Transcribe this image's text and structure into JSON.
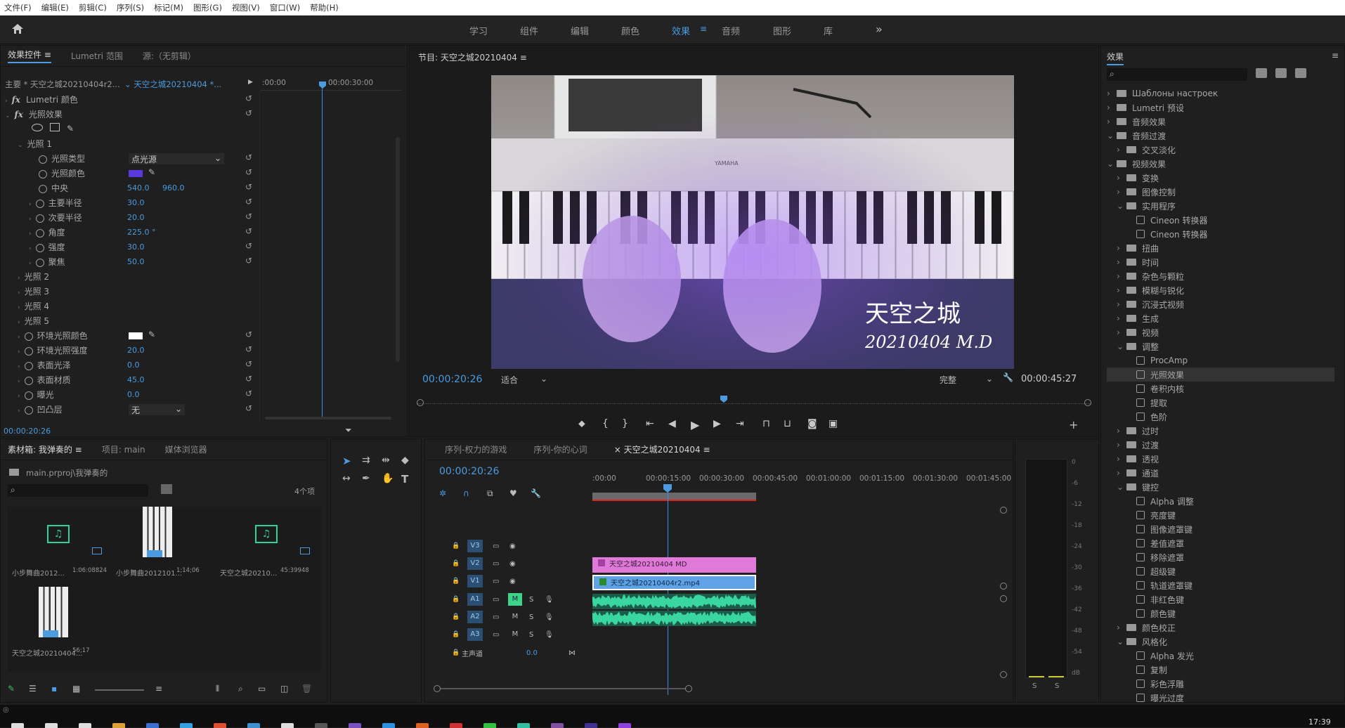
{
  "menu": [
    "文件(F)",
    "编辑(E)",
    "剪辑(C)",
    "序列(S)",
    "标记(M)",
    "图形(G)",
    "视图(V)",
    "窗口(W)",
    "帮助(H)"
  ],
  "workspaces": [
    "学习",
    "组件",
    "编辑",
    "颜色",
    "效果",
    "音频",
    "图形",
    "库"
  ],
  "workspace_active": "效果",
  "effect_controls": {
    "tabs": [
      "效果控件",
      "Lumetri 范围",
      "源:（无剪辑）"
    ],
    "master_clip": "主要 * 天空之城20210404r2...",
    "sequence_clip": "天空之城20210404 *...",
    "ruler_start": ":00:00",
    "ruler_end": "00:00:30:00",
    "lumetri": "Lumetri 颜色",
    "lighting": "光照效果",
    "light1": "光照 1",
    "params": [
      {
        "label": "光照类型",
        "value": "点光源"
      },
      {
        "label": "光照颜色",
        "value": ""
      },
      {
        "label": "中央",
        "value": "540.0",
        "value2": "960.0"
      },
      {
        "label": "主要半径",
        "value": "30.0"
      },
      {
        "label": "次要半径",
        "value": "20.0"
      },
      {
        "label": "角度",
        "value": "225.0 °"
      },
      {
        "label": "强度",
        "value": "30.0"
      },
      {
        "label": "聚焦",
        "value": "50.0"
      }
    ],
    "lights": [
      "光照 2",
      "光照 3",
      "光照 4",
      "光照 5"
    ],
    "ambient": [
      {
        "label": "环境光照颜色",
        "value": ""
      },
      {
        "label": "环境光照强度",
        "value": "20.0"
      },
      {
        "label": "表面光泽",
        "value": "0.0"
      },
      {
        "label": "表面材质",
        "value": "45.0"
      },
      {
        "label": "曝光",
        "value": "0.0"
      },
      {
        "label": "凹凸层",
        "value": "无"
      }
    ],
    "timecode": "00:00:20:26"
  },
  "program": {
    "title": "节目: 天空之城20210404",
    "overlay_title": "天空之城",
    "overlay_sub": "20210404 M.D",
    "brand": "YAMAHA",
    "timecode": "00:00:20:26",
    "fit": "适合",
    "quality": "完整",
    "duration": "00:00:45:27",
    "playhead": 0.45
  },
  "effects": {
    "title": "效果",
    "tree": [
      {
        "d": 0,
        "t": "folder",
        "l": "Шаблоны настроек"
      },
      {
        "d": 0,
        "t": "folder",
        "l": "Lumetri 预设"
      },
      {
        "d": 0,
        "t": "folder",
        "l": "音频效果"
      },
      {
        "d": 0,
        "t": "folder",
        "l": "音频过渡",
        "open": true
      },
      {
        "d": 1,
        "t": "folder",
        "l": "交叉淡化"
      },
      {
        "d": 0,
        "t": "folder",
        "l": "视频效果",
        "open": true
      },
      {
        "d": 1,
        "t": "folder",
        "l": "变换"
      },
      {
        "d": 1,
        "t": "folder",
        "l": "图像控制"
      },
      {
        "d": 1,
        "t": "folder",
        "l": "实用程序",
        "open": true
      },
      {
        "d": 2,
        "t": "fx",
        "l": "Cineon 转换器"
      },
      {
        "d": 2,
        "t": "fx",
        "l": "Cineon 转换器"
      },
      {
        "d": 1,
        "t": "folder",
        "l": "扭曲"
      },
      {
        "d": 1,
        "t": "folder",
        "l": "时间"
      },
      {
        "d": 1,
        "t": "folder",
        "l": "杂色与颗粒"
      },
      {
        "d": 1,
        "t": "folder",
        "l": "模糊与锐化"
      },
      {
        "d": 1,
        "t": "folder",
        "l": "沉浸式视频"
      },
      {
        "d": 1,
        "t": "folder",
        "l": "生成"
      },
      {
        "d": 1,
        "t": "folder",
        "l": "视频"
      },
      {
        "d": 1,
        "t": "folder",
        "l": "调整",
        "open": true
      },
      {
        "d": 2,
        "t": "fx",
        "l": "ProcAmp"
      },
      {
        "d": 2,
        "t": "fx",
        "l": "光照效果",
        "sel": true
      },
      {
        "d": 2,
        "t": "fx",
        "l": "卷积内核"
      },
      {
        "d": 2,
        "t": "fx",
        "l": "提取"
      },
      {
        "d": 2,
        "t": "fx",
        "l": "色阶"
      },
      {
        "d": 1,
        "t": "folder",
        "l": "过时"
      },
      {
        "d": 1,
        "t": "folder",
        "l": "过渡"
      },
      {
        "d": 1,
        "t": "folder",
        "l": "透视"
      },
      {
        "d": 1,
        "t": "folder",
        "l": "通道"
      },
      {
        "d": 1,
        "t": "folder",
        "l": "键控",
        "open": true
      },
      {
        "d": 2,
        "t": "fx",
        "l": "Alpha 调整"
      },
      {
        "d": 2,
        "t": "fx",
        "l": "亮度键"
      },
      {
        "d": 2,
        "t": "fx",
        "l": "图像遮罩键"
      },
      {
        "d": 2,
        "t": "fx",
        "l": "差值遮罩"
      },
      {
        "d": 2,
        "t": "fx",
        "l": "移除遮罩"
      },
      {
        "d": 2,
        "t": "fx",
        "l": "超级键"
      },
      {
        "d": 2,
        "t": "fx",
        "l": "轨道遮罩键"
      },
      {
        "d": 2,
        "t": "fx",
        "l": "非红色键"
      },
      {
        "d": 2,
        "t": "fx",
        "l": "颜色键"
      },
      {
        "d": 1,
        "t": "folder",
        "l": "颜色校正"
      },
      {
        "d": 1,
        "t": "folder",
        "l": "风格化",
        "open": true
      },
      {
        "d": 2,
        "t": "fx",
        "l": "Alpha 发光"
      },
      {
        "d": 2,
        "t": "fx",
        "l": "复制"
      },
      {
        "d": 2,
        "t": "fx",
        "l": "彩色浮雕"
      },
      {
        "d": 2,
        "t": "fx",
        "l": "曝光过度"
      }
    ]
  },
  "project": {
    "tabs": [
      "素材箱: 我弹奏的",
      "项目: main",
      "媒体浏览器"
    ],
    "path": "main.prproj\\我弹奏的",
    "count": "4个项",
    "items": [
      {
        "name": "小步舞曲2012...",
        "dur": "1:06:08824",
        "kind": "audio"
      },
      {
        "name": "小步舞曲2012101...",
        "dur": "1;14;06",
        "kind": "video"
      },
      {
        "name": "天空之城20210...",
        "dur": "45:39948",
        "kind": "audio"
      },
      {
        "name": "天空之城20210404...",
        "dur": "56;17",
        "kind": "video"
      }
    ]
  },
  "timeline": {
    "tabs": [
      "序列-权力的游戏",
      "序列-你的心词",
      "天空之城20210404"
    ],
    "timecode": "00:00:20:26",
    "ruler": [
      ":00:00",
      "00:00:15:00",
      "00:00:30:00",
      "00:00:45:00",
      "00:01:00:00",
      "00:01:15:00",
      "00:01:30:00",
      "00:01:45:00"
    ],
    "video_tracks": [
      "V3",
      "V2",
      "V1"
    ],
    "audio_tracks": [
      "A1",
      "A2",
      "A3"
    ],
    "master": "主声道",
    "master_val": "0.0",
    "clip_v2": "天空之城20210404 MD",
    "clip_v1": "天空之城20210404r2.mp4",
    "m_label": "M",
    "s_label": "S"
  },
  "meters": {
    "scale": [
      "0",
      "-6",
      "-12",
      "-18",
      "-24",
      "-30",
      "-36",
      "-42",
      "-48",
      "-54",
      "dB"
    ],
    "solo": [
      "S",
      "S"
    ]
  },
  "taskbar": {
    "time": "17:39"
  }
}
